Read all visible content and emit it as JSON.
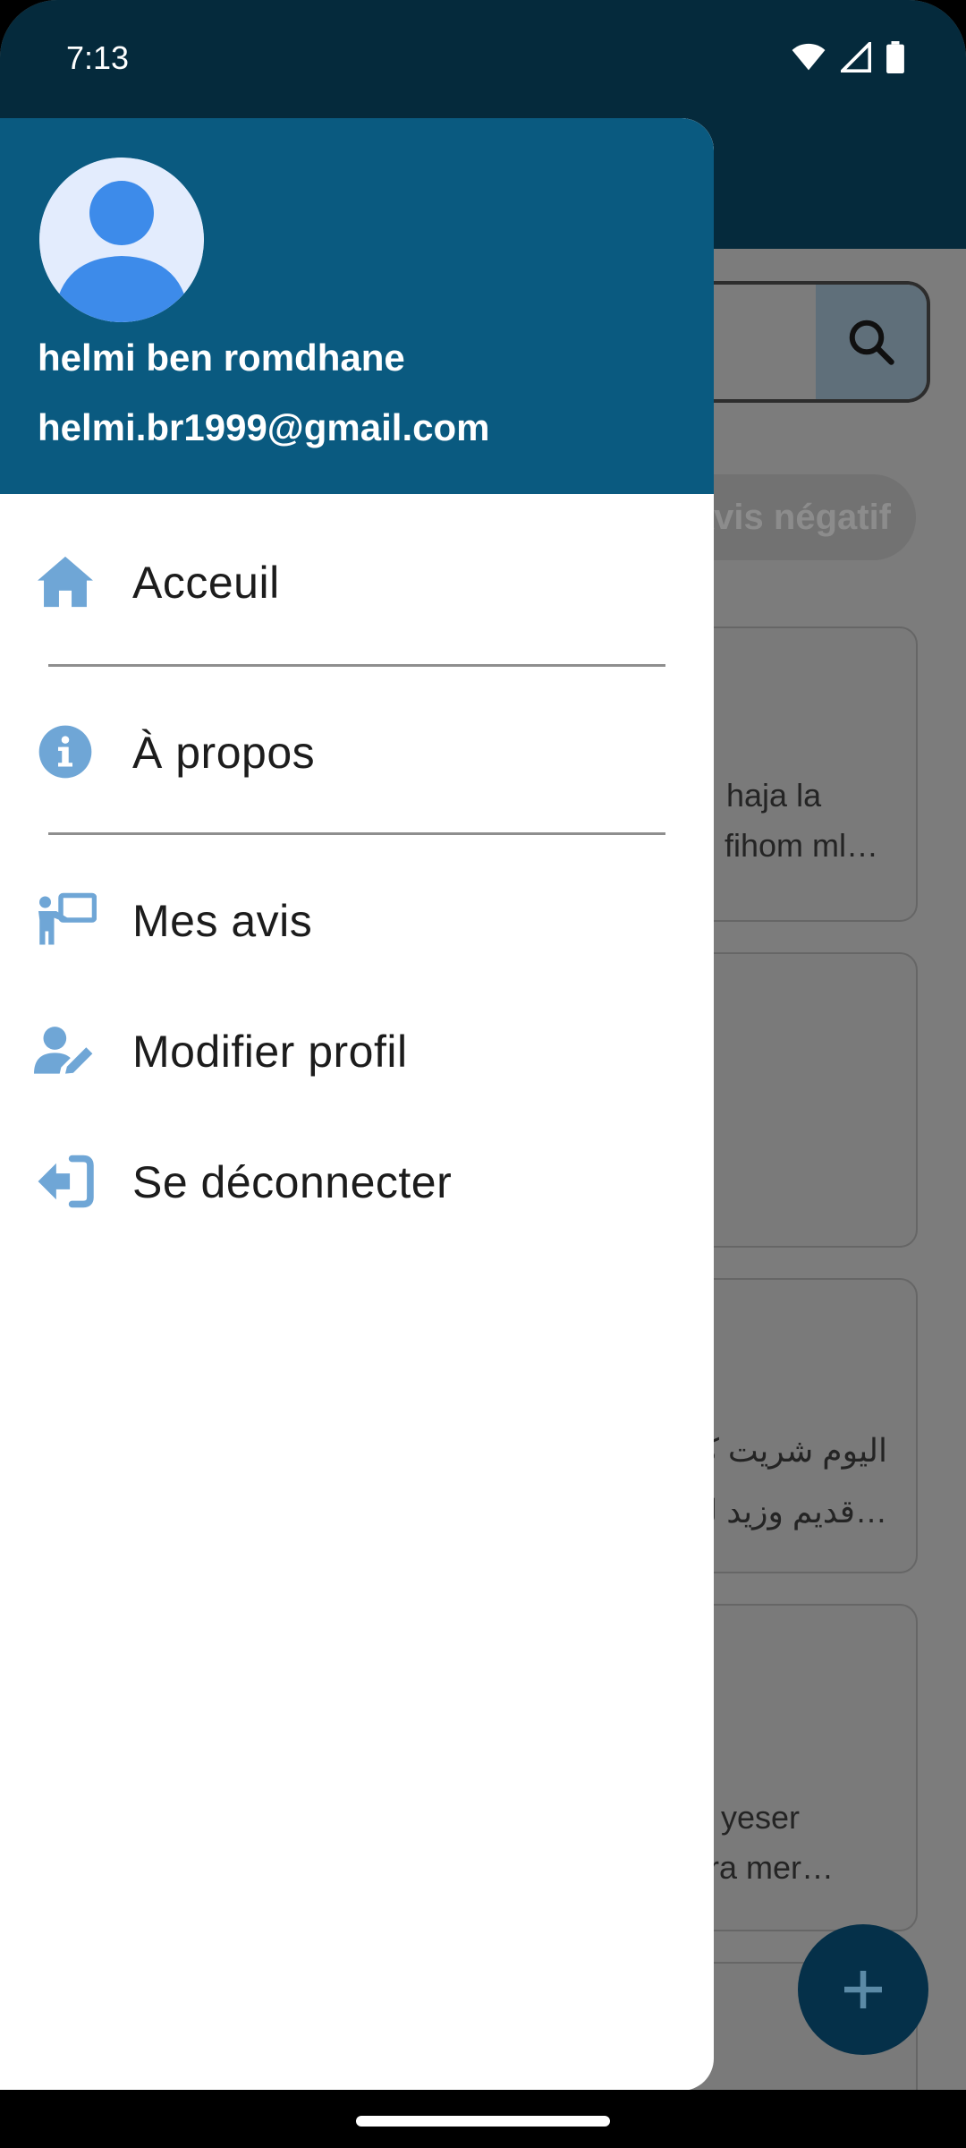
{
  "status_bar": {
    "time": "7:13"
  },
  "background": {
    "filter_chip": "Avis négatif",
    "cards": [
      {
        "line1": "haja la",
        "line2": "fihom ml…"
      },
      {
        "line1": "",
        "line2": ""
      },
      {
        "line1": "اليوم شريت كر",
        "line2": "قديم وزيد لو…"
      },
      {
        "line1": "s w yeser",
        "line2": "yarra mer…"
      }
    ]
  },
  "drawer": {
    "user_name": "helmi ben romdhane",
    "user_email": "helmi.br1999@gmail.com",
    "menu": [
      {
        "label": "Acceuil",
        "icon": "home-icon"
      },
      {
        "label": "À propos",
        "icon": "info-icon"
      },
      {
        "label": "Mes avis",
        "icon": "presentation-icon"
      },
      {
        "label": "Modifier profil",
        "icon": "user-edit-icon"
      },
      {
        "label": "Se déconnecter",
        "icon": "logout-icon"
      }
    ]
  },
  "colors": {
    "drawer_header": "#0a5a80",
    "app_bar": "#052a3c",
    "menu_icon": "#6fa6d6"
  }
}
